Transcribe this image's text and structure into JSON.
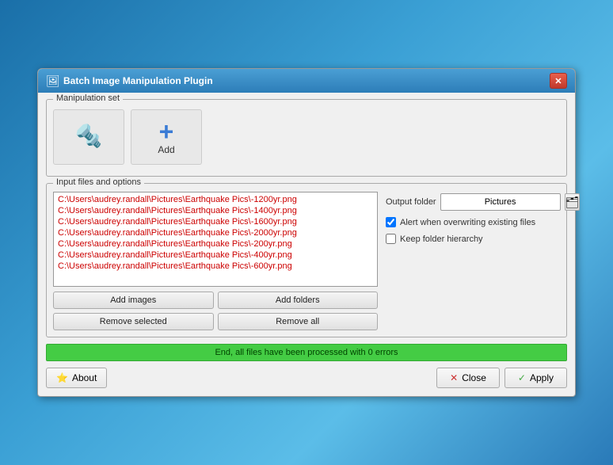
{
  "window": {
    "title": "Batch Image Manipulation Plugin",
    "close_label": "✕"
  },
  "manipulation_set": {
    "label": "Manipulation set",
    "items": [
      {
        "icon": "🔩",
        "label": ""
      },
      {
        "icon": "+",
        "label": "Add"
      }
    ]
  },
  "input_files": {
    "label": "Input files and options",
    "files": [
      "C:\\Users\\audrey.randall\\Pictures\\Earthquake Pics\\-1200yr.png",
      "C:\\Users\\audrey.randall\\Pictures\\Earthquake Pics\\-1400yr.png",
      "C:\\Users\\audrey.randall\\Pictures\\Earthquake Pics\\-1600yr.png",
      "C:\\Users\\audrey.randall\\Pictures\\Earthquake Pics\\-2000yr.png",
      "C:\\Users\\audrey.randall\\Pictures\\Earthquake Pics\\-200yr.png",
      "C:\\Users\\audrey.randall\\Pictures\\Earthquake Pics\\-400yr.png",
      "C:\\Users\\audrey.randall\\Pictures\\Earthquake Pics\\-600yr.png"
    ],
    "buttons": {
      "add_images": "Add images",
      "add_folders": "Add folders",
      "remove_selected": "Remove selected",
      "remove_all": "Remove all"
    }
  },
  "output": {
    "label": "Output folder",
    "folder_value": "Pictures",
    "folder_placeholder": "Pictures",
    "alert_overwrite_label": "Alert when overwriting existing files",
    "alert_overwrite_checked": true,
    "keep_hierarchy_label": "Keep folder hierarchy",
    "keep_hierarchy_checked": false
  },
  "status": {
    "message": "End, all files have been processed with 0 errors"
  },
  "bottom_buttons": {
    "about": "About",
    "close": "Close",
    "apply": "Apply"
  }
}
